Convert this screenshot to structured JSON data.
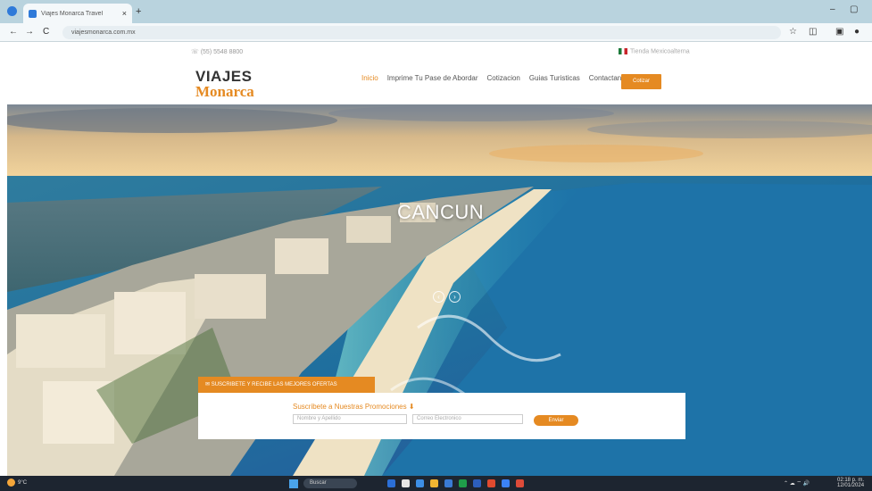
{
  "browser": {
    "tab_title": "Viajes Monarca Travel",
    "tab_close": "×",
    "new_tab": "+",
    "url": "viajesmonarca.com.mx",
    "window_min": "–",
    "window_max": "▢",
    "back": "←",
    "forward": "→",
    "reload": "C",
    "site_info": "⚙",
    "star": "☆"
  },
  "site": {
    "topbar": {
      "phone": "☏ (55) 5548 8800",
      "language": "Tienda Mexicoalterna"
    },
    "logo": {
      "line1": "VIAJES",
      "line2": "Monarca"
    },
    "nav": {
      "items": [
        "Inicio",
        "Imprime Tu Pase de Abordar",
        "Cotizacion",
        "Guias Turisticas",
        "Contactanos"
      ],
      "cta": "Cotizar"
    },
    "hero": {
      "title": "CANCUN",
      "prev": "‹",
      "next": "›"
    },
    "subscribe": {
      "tab_label": "✉ SUSCRIBETE Y RECIBE LAS MEJORES OFERTAS",
      "title": "Suscribete a Nuestras Promociones ⬇",
      "name_placeholder": "Nombre y Apellido",
      "email_placeholder": "Correo Electronico",
      "button": "Enviar"
    }
  },
  "taskbar": {
    "weather_temp": "9°C",
    "weather_desc": "Soleado",
    "search": "Buscar",
    "time": "02:18 p. m.",
    "date": "12/01/2024"
  },
  "colors": {
    "accent": "#e58a22",
    "chrome": "#b9d3de",
    "taskbar": "#1d2530"
  }
}
